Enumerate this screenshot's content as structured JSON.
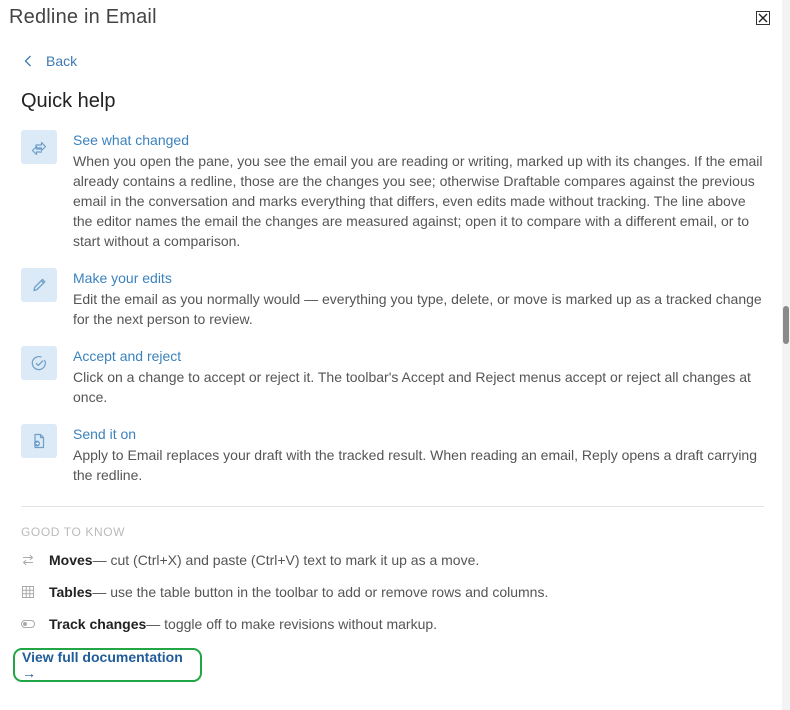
{
  "window": {
    "title": "Redline in Email"
  },
  "nav": {
    "back_label": "Back"
  },
  "section_title": "Quick help",
  "help_items": [
    {
      "icon": "arrows-swap-icon",
      "heading": "See what changed",
      "body": "When you open the pane, you see the email you are reading or writing, marked up with its changes. If the email already contains a redline, those are the changes you see; otherwise Draftable compares against the previous email in the conversation and marks everything that differs, even edits made without tracking. The line above the editor names the email the changes are measured against; open it to compare with a different email, or to start without a comparison."
    },
    {
      "icon": "pencil-icon",
      "heading": "Make your edits",
      "body": "Edit the email as you normally would — everything you type, delete, or move is marked up as a tracked change for the next person to review."
    },
    {
      "icon": "check-circle-icon",
      "heading": "Accept and reject",
      "body": "Click on a change to accept or reject it. The toolbar's Accept and Reject menus accept or reject all changes at once."
    },
    {
      "icon": "send-document-icon",
      "heading": "Send it on",
      "body": "Apply to Email replaces your draft with the tracked result. When reading an email, Reply opens a draft carrying the redline."
    }
  ],
  "good_to_know": {
    "label": "GOOD TO KNOW",
    "tips": [
      {
        "icon": "swap-icon",
        "term": "Moves",
        "text": " — cut (Ctrl+X) and paste (Ctrl+V) text to mark it up as a move."
      },
      {
        "icon": "table-icon",
        "term": "Tables",
        "text": " — use the table button in the toolbar to add or remove rows and columns."
      },
      {
        "icon": "toggle-icon",
        "term": "Track changes",
        "text": " — toggle off to make revisions without markup."
      }
    ]
  },
  "docs_link": {
    "label": "View full documentation →"
  },
  "colors": {
    "accent": "#3a82be",
    "link": "#1f5c99",
    "icon_bg": "#dbeaf6",
    "highlight": "#22a544"
  }
}
